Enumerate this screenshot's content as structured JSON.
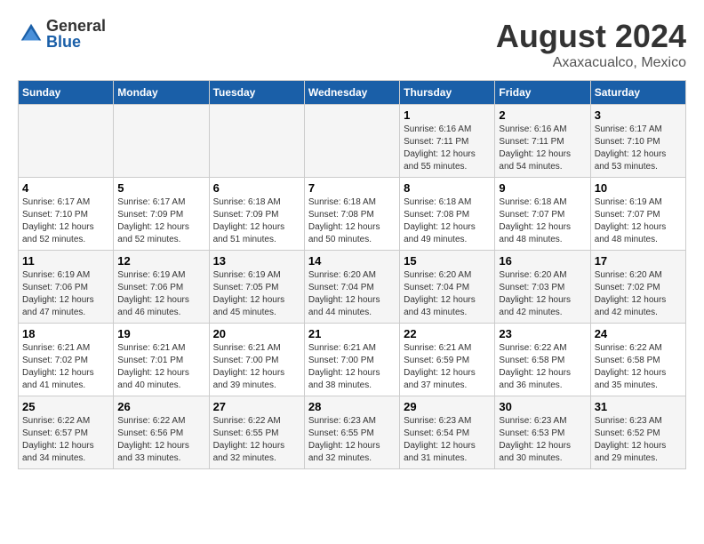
{
  "logo": {
    "general": "General",
    "blue": "Blue"
  },
  "title": {
    "month_year": "August 2024",
    "location": "Axaxacualco, Mexico"
  },
  "days_of_week": [
    "Sunday",
    "Monday",
    "Tuesday",
    "Wednesday",
    "Thursday",
    "Friday",
    "Saturday"
  ],
  "weeks": [
    [
      {
        "day": "",
        "detail": ""
      },
      {
        "day": "",
        "detail": ""
      },
      {
        "day": "",
        "detail": ""
      },
      {
        "day": "",
        "detail": ""
      },
      {
        "day": "1",
        "detail": "Sunrise: 6:16 AM\nSunset: 7:11 PM\nDaylight: 12 hours\nand 55 minutes."
      },
      {
        "day": "2",
        "detail": "Sunrise: 6:16 AM\nSunset: 7:11 PM\nDaylight: 12 hours\nand 54 minutes."
      },
      {
        "day": "3",
        "detail": "Sunrise: 6:17 AM\nSunset: 7:10 PM\nDaylight: 12 hours\nand 53 minutes."
      }
    ],
    [
      {
        "day": "4",
        "detail": "Sunrise: 6:17 AM\nSunset: 7:10 PM\nDaylight: 12 hours\nand 52 minutes."
      },
      {
        "day": "5",
        "detail": "Sunrise: 6:17 AM\nSunset: 7:09 PM\nDaylight: 12 hours\nand 52 minutes."
      },
      {
        "day": "6",
        "detail": "Sunrise: 6:18 AM\nSunset: 7:09 PM\nDaylight: 12 hours\nand 51 minutes."
      },
      {
        "day": "7",
        "detail": "Sunrise: 6:18 AM\nSunset: 7:08 PM\nDaylight: 12 hours\nand 50 minutes."
      },
      {
        "day": "8",
        "detail": "Sunrise: 6:18 AM\nSunset: 7:08 PM\nDaylight: 12 hours\nand 49 minutes."
      },
      {
        "day": "9",
        "detail": "Sunrise: 6:18 AM\nSunset: 7:07 PM\nDaylight: 12 hours\nand 48 minutes."
      },
      {
        "day": "10",
        "detail": "Sunrise: 6:19 AM\nSunset: 7:07 PM\nDaylight: 12 hours\nand 48 minutes."
      }
    ],
    [
      {
        "day": "11",
        "detail": "Sunrise: 6:19 AM\nSunset: 7:06 PM\nDaylight: 12 hours\nand 47 minutes."
      },
      {
        "day": "12",
        "detail": "Sunrise: 6:19 AM\nSunset: 7:06 PM\nDaylight: 12 hours\nand 46 minutes."
      },
      {
        "day": "13",
        "detail": "Sunrise: 6:19 AM\nSunset: 7:05 PM\nDaylight: 12 hours\nand 45 minutes."
      },
      {
        "day": "14",
        "detail": "Sunrise: 6:20 AM\nSunset: 7:04 PM\nDaylight: 12 hours\nand 44 minutes."
      },
      {
        "day": "15",
        "detail": "Sunrise: 6:20 AM\nSunset: 7:04 PM\nDaylight: 12 hours\nand 43 minutes."
      },
      {
        "day": "16",
        "detail": "Sunrise: 6:20 AM\nSunset: 7:03 PM\nDaylight: 12 hours\nand 42 minutes."
      },
      {
        "day": "17",
        "detail": "Sunrise: 6:20 AM\nSunset: 7:02 PM\nDaylight: 12 hours\nand 42 minutes."
      }
    ],
    [
      {
        "day": "18",
        "detail": "Sunrise: 6:21 AM\nSunset: 7:02 PM\nDaylight: 12 hours\nand 41 minutes."
      },
      {
        "day": "19",
        "detail": "Sunrise: 6:21 AM\nSunset: 7:01 PM\nDaylight: 12 hours\nand 40 minutes."
      },
      {
        "day": "20",
        "detail": "Sunrise: 6:21 AM\nSunset: 7:00 PM\nDaylight: 12 hours\nand 39 minutes."
      },
      {
        "day": "21",
        "detail": "Sunrise: 6:21 AM\nSunset: 7:00 PM\nDaylight: 12 hours\nand 38 minutes."
      },
      {
        "day": "22",
        "detail": "Sunrise: 6:21 AM\nSunset: 6:59 PM\nDaylight: 12 hours\nand 37 minutes."
      },
      {
        "day": "23",
        "detail": "Sunrise: 6:22 AM\nSunset: 6:58 PM\nDaylight: 12 hours\nand 36 minutes."
      },
      {
        "day": "24",
        "detail": "Sunrise: 6:22 AM\nSunset: 6:58 PM\nDaylight: 12 hours\nand 35 minutes."
      }
    ],
    [
      {
        "day": "25",
        "detail": "Sunrise: 6:22 AM\nSunset: 6:57 PM\nDaylight: 12 hours\nand 34 minutes."
      },
      {
        "day": "26",
        "detail": "Sunrise: 6:22 AM\nSunset: 6:56 PM\nDaylight: 12 hours\nand 33 minutes."
      },
      {
        "day": "27",
        "detail": "Sunrise: 6:22 AM\nSunset: 6:55 PM\nDaylight: 12 hours\nand 32 minutes."
      },
      {
        "day": "28",
        "detail": "Sunrise: 6:23 AM\nSunset: 6:55 PM\nDaylight: 12 hours\nand 32 minutes."
      },
      {
        "day": "29",
        "detail": "Sunrise: 6:23 AM\nSunset: 6:54 PM\nDaylight: 12 hours\nand 31 minutes."
      },
      {
        "day": "30",
        "detail": "Sunrise: 6:23 AM\nSunset: 6:53 PM\nDaylight: 12 hours\nand 30 minutes."
      },
      {
        "day": "31",
        "detail": "Sunrise: 6:23 AM\nSunset: 6:52 PM\nDaylight: 12 hours\nand 29 minutes."
      }
    ]
  ]
}
